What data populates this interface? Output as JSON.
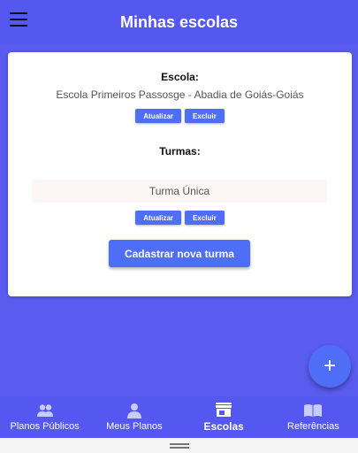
{
  "app_bar": {
    "title": "Minhas escolas",
    "menu_icon": "hamburger-icon"
  },
  "card": {
    "school_label": "Escola:",
    "school_name": "Escola Primeiros Passosge - Abadia de Goiás-Goiás",
    "school_update": "Atualizar",
    "school_delete": "Excluir",
    "classes_label": "Turmas:",
    "classes": [
      {
        "name": "Turma Única"
      }
    ],
    "class_update": "Atualizar",
    "class_delete": "Excluir",
    "new_class_button": "Cadastrar nova turma"
  },
  "fab": {
    "label": "+",
    "icon": "plus-icon"
  },
  "bottom_nav": {
    "items": [
      {
        "label": "Planos Públicos",
        "icon": "people-icon",
        "active": false
      },
      {
        "label": "Meus Planos",
        "icon": "person-icon",
        "active": false
      },
      {
        "label": "Escolas",
        "icon": "store-icon",
        "active": true
      },
      {
        "label": "Referências",
        "icon": "book-icon",
        "active": false
      }
    ]
  },
  "colors": {
    "primary": "#5457f0",
    "button": "#4f6ef7",
    "background": "#5a5cf0"
  }
}
